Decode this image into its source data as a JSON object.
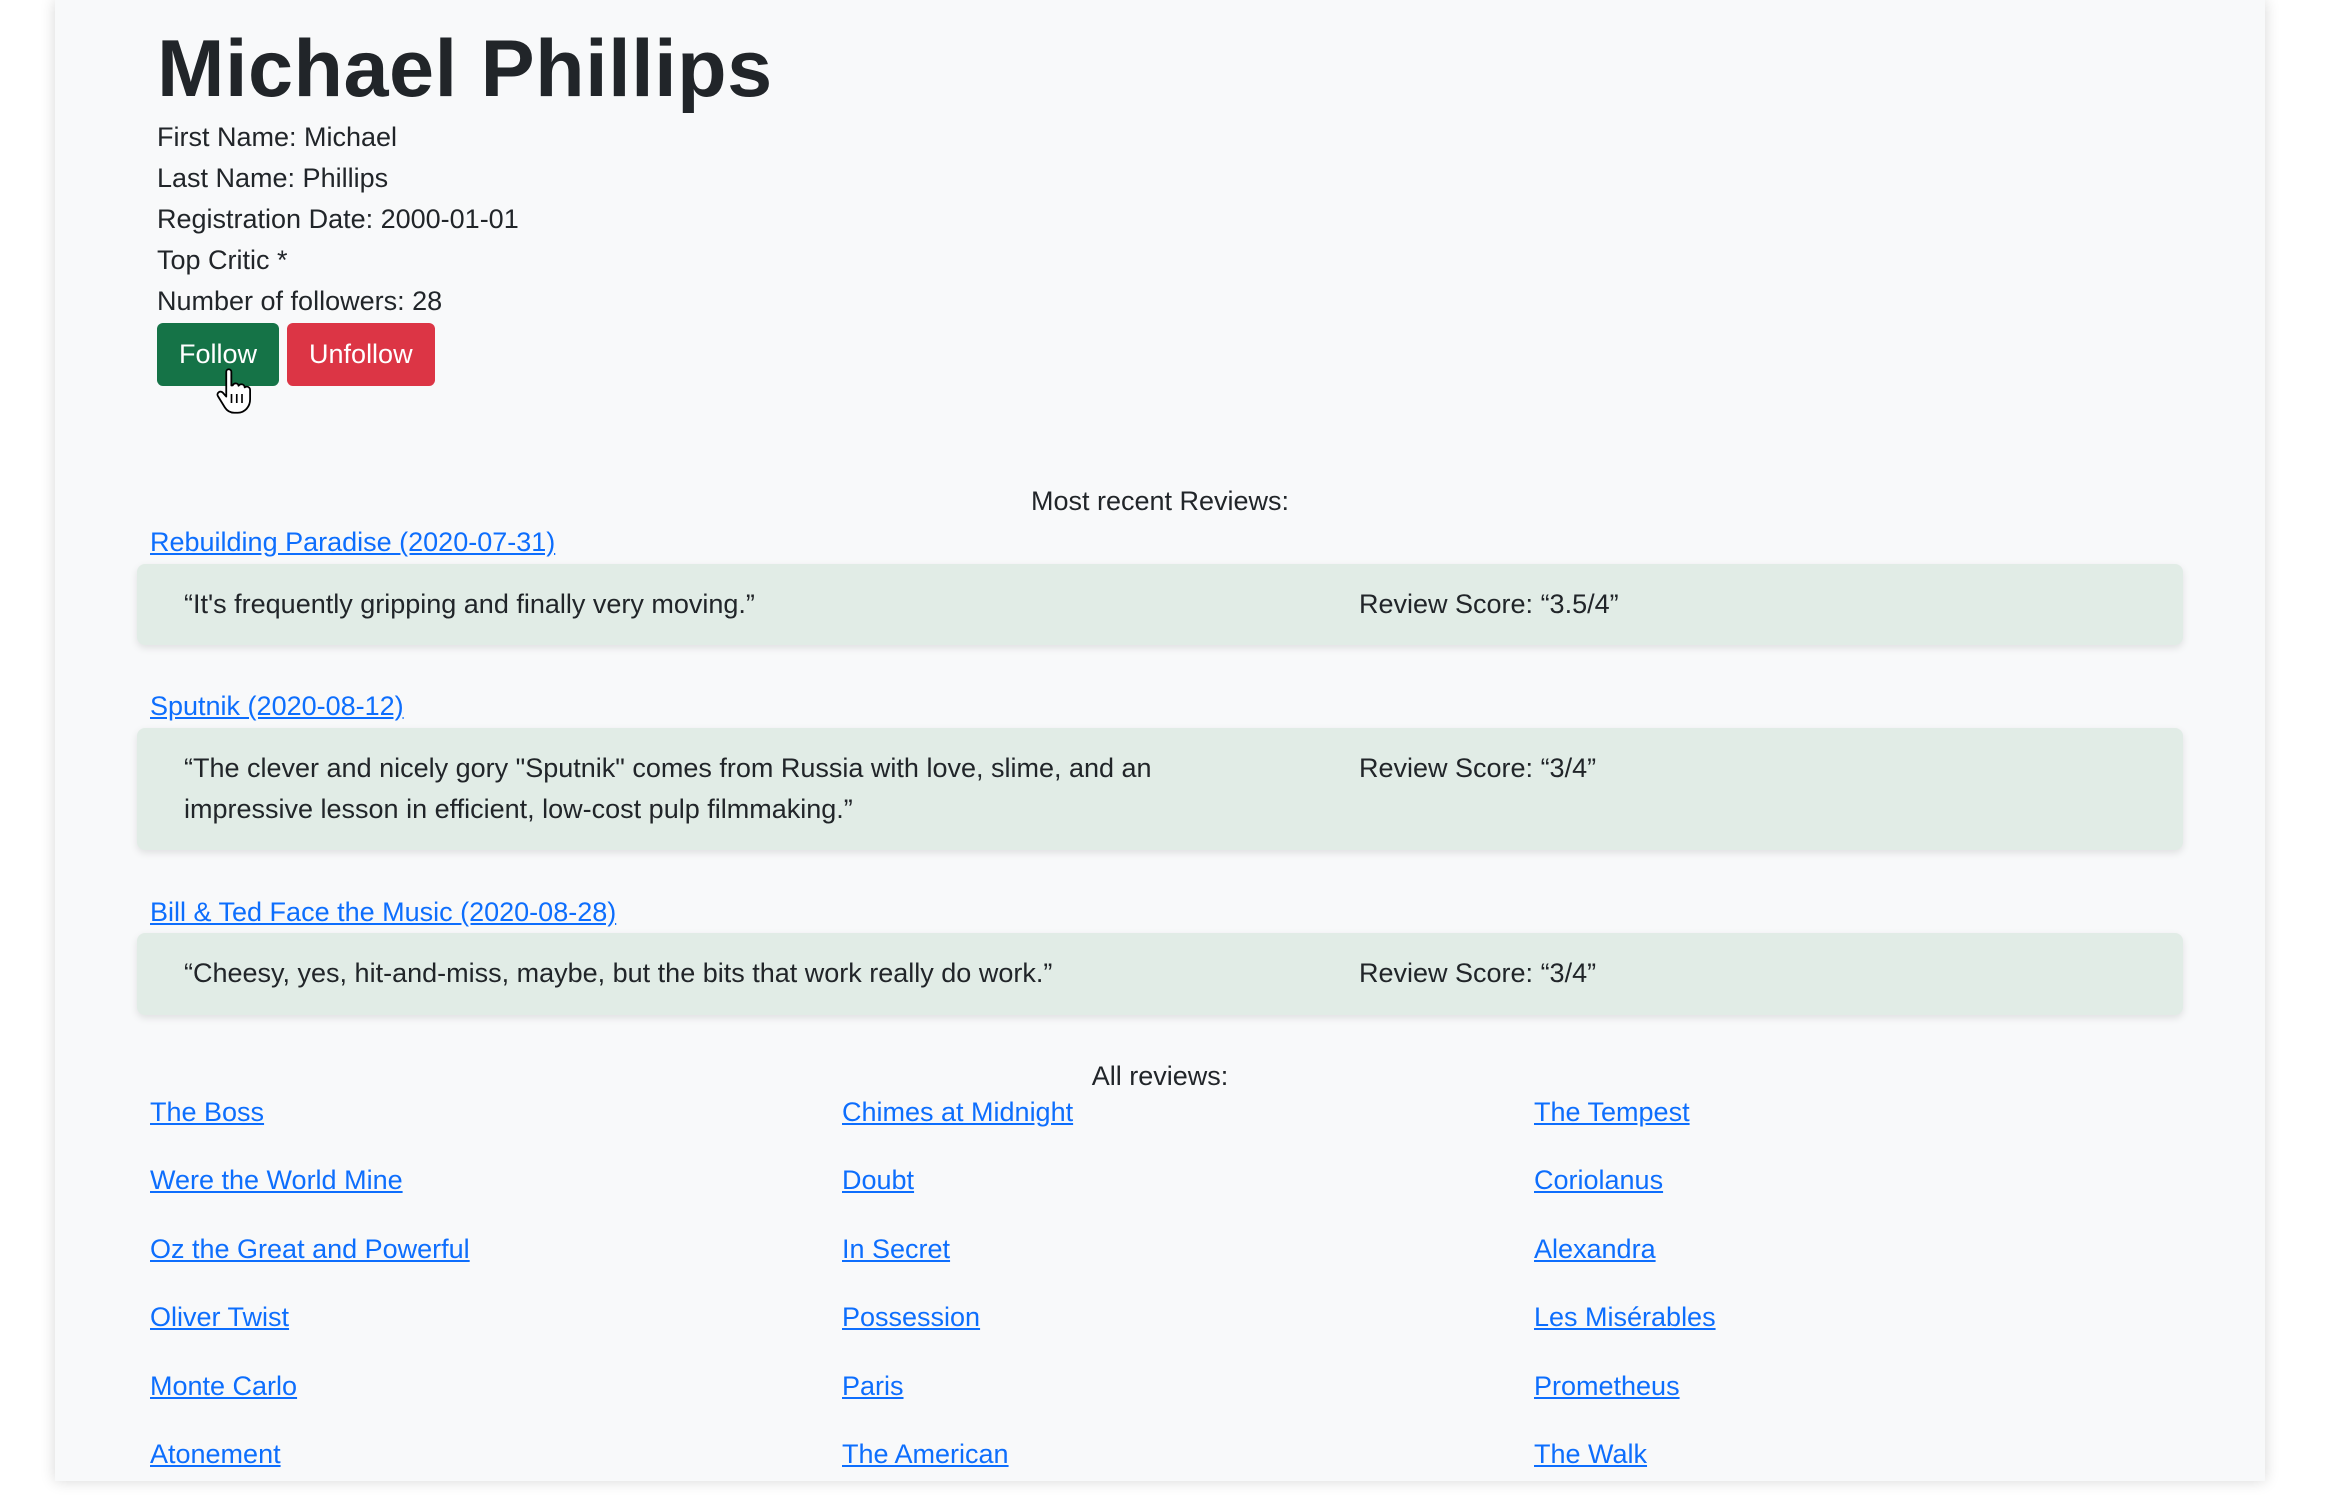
{
  "profile": {
    "name": "Michael Phillips",
    "first_name": "First Name: Michael",
    "last_name": "Last Name: Phillips",
    "registration_date": "Registration Date: 2000-01-01",
    "top_critic": "Top Critic *",
    "followers": "Number of followers: 28",
    "follow_label": "Follow",
    "unfollow_label": "Unfollow"
  },
  "recent": {
    "title": "Most recent Reviews:",
    "items": [
      {
        "link": "Rebuilding Paradise (2020-07-31)",
        "quote": "“It's frequently gripping and finally very moving.”",
        "score": "Review Score: “3.5/4”"
      },
      {
        "link": "Sputnik (2020-08-12)",
        "quote": "“The clever and nicely gory \"Sputnik\" comes from Russia with love, slime, and an impressive lesson in efficient, low-cost pulp filmmaking.”",
        "score": "Review Score: “3/4”"
      },
      {
        "link": "Bill & Ted Face the Music (2020-08-28)",
        "quote": "“Cheesy, yes, hit-and-miss, maybe, but the bits that work really do work.”",
        "score": "Review Score: “3/4”"
      }
    ]
  },
  "all_reviews": {
    "title": "All reviews:",
    "items": [
      "The Boss",
      "Chimes at Midnight",
      "The Tempest",
      "Were the World Mine",
      "Doubt",
      "Coriolanus",
      "Oz the Great and Powerful",
      "In Secret",
      "Alexandra",
      "Oliver Twist",
      "Possession",
      "Les Misérables",
      "Monte Carlo",
      "Paris",
      "Prometheus",
      "Atonement",
      "The American",
      "The Walk"
    ]
  },
  "colors": {
    "page_bg": "#f8f9fa",
    "follow_button": "#157347",
    "unfollow_button": "#dc3545",
    "link": "#0d6efd",
    "review_card": "#e1ece6"
  }
}
